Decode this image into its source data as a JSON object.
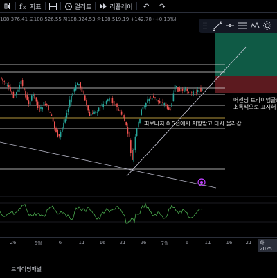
{
  "toolbar": {
    "indicators_label": "지표",
    "alert_label": "얼러트",
    "replay_label": "리플레이"
  },
  "ohlc": {
    "text": "108,376.41  고108,526.55  저108,324.53  종108,519.19  +142.78 (+0.13%)"
  },
  "annotations": {
    "ascending_triangle_line1": "어센딩 트라이앵글로",
    "ascending_triangle_line2": "초록색으로 표시해",
    "fib_note": "피보나치 0.5선에서 저항받고 다시 올라감"
  },
  "xaxis": {
    "ticks": [
      "26",
      "6월",
      "6",
      "11",
      "16",
      "21",
      "26",
      "7월",
      "6",
      "11",
      "16",
      "21"
    ],
    "date_badge": "화 2025"
  },
  "bottom_panel": {
    "label": "트레이딩패널"
  },
  "colors": {
    "background": "#000000",
    "candle_up": "#26a69a",
    "candle_down": "#ef5350",
    "fib_line": "#e0e0e0",
    "fib_half_line": "#f0c850",
    "target_zone": "#0f5a45",
    "stop_zone": "#5c1a1f",
    "trendline": "#b8b8c8",
    "oscillator": "#4caf50"
  },
  "icons": [
    "candle-type-icon",
    "indicators-icon",
    "layout-icon",
    "alert-icon",
    "replay-icon",
    "undo-icon",
    "redo-icon",
    "drag-handle-icon",
    "trendline-tool-icon",
    "horizontal-line-tool-icon",
    "fib-tool-icon",
    "pattern-tool-icon",
    "settings-tool-icon"
  ]
}
